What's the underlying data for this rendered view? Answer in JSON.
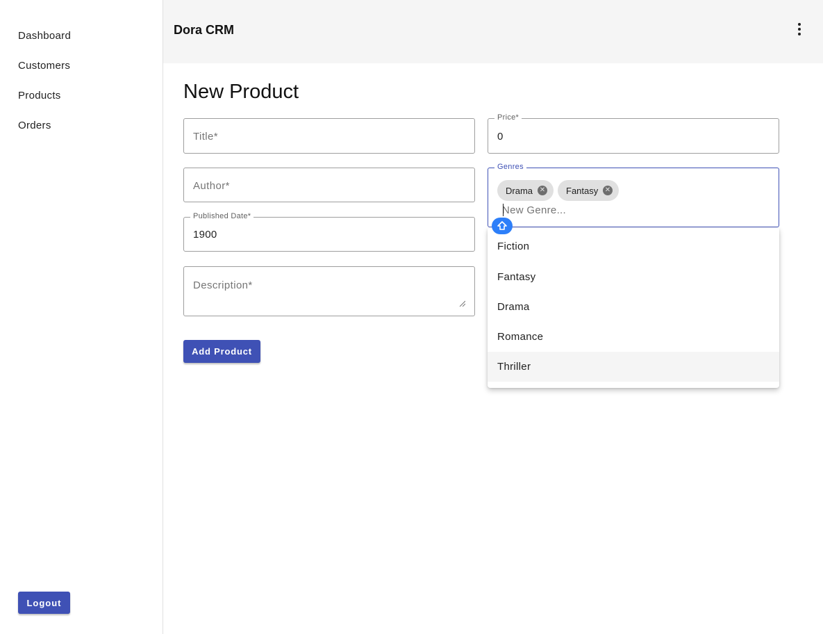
{
  "sidebar": {
    "items": [
      {
        "label": "Dashboard"
      },
      {
        "label": "Customers"
      },
      {
        "label": "Products"
      },
      {
        "label": "Orders"
      }
    ],
    "logout_label": "Logout"
  },
  "header": {
    "title": "Dora CRM",
    "menu_icon": "more-vert-icon"
  },
  "main": {
    "title": "New Product",
    "fields": {
      "title": {
        "placeholder": "Title*"
      },
      "price": {
        "label": "Price*",
        "value": "0"
      },
      "author": {
        "placeholder": "Author*"
      },
      "published_date": {
        "label": "Published Date*",
        "value": "1900"
      },
      "description": {
        "placeholder": "Description*"
      }
    },
    "genres": {
      "label": "Genres",
      "chips": [
        {
          "label": "Drama"
        },
        {
          "label": "Fantasy"
        }
      ],
      "input_placeholder": "New Genre...",
      "options": [
        {
          "label": "Fiction"
        },
        {
          "label": "Fantasy"
        },
        {
          "label": "Drama"
        },
        {
          "label": "Romance"
        },
        {
          "label": "Thriller",
          "highlighted": true
        }
      ]
    },
    "submit_label": "Add Product"
  },
  "colors": {
    "primary": "#3f51b5",
    "header_bg": "#f5f5f5",
    "chip_bg": "#e0e0e0",
    "badge": "#2d7ff9"
  }
}
